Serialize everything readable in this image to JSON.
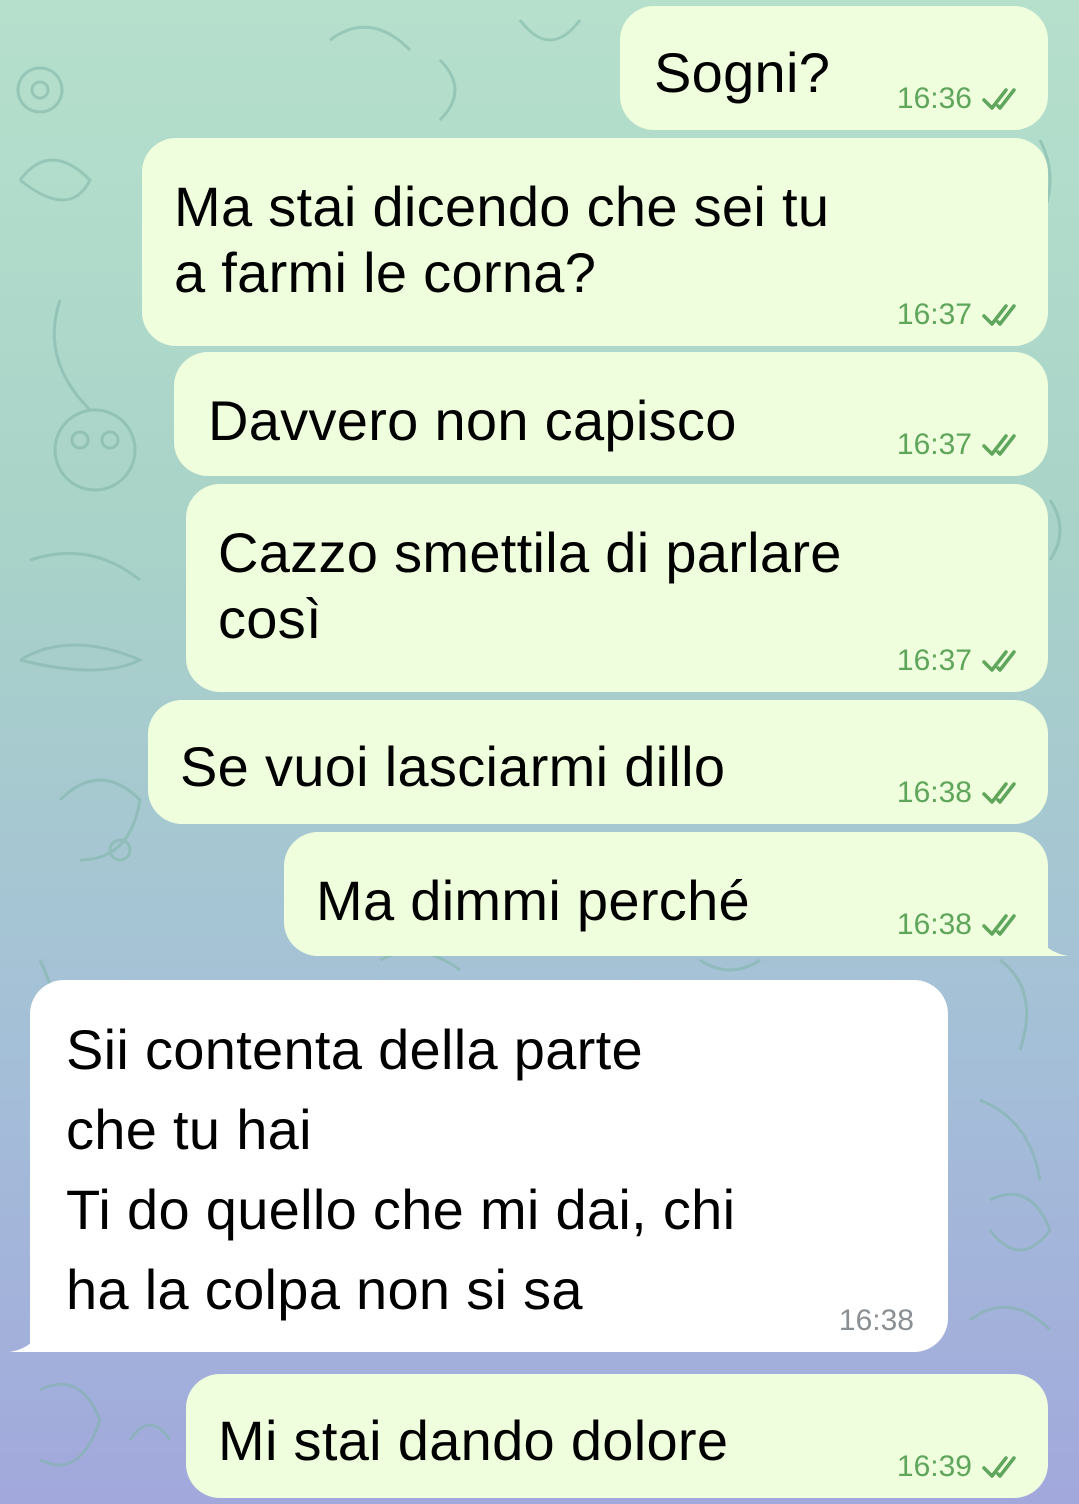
{
  "colors": {
    "outgoing_bubble": "#effedd",
    "incoming_bubble": "#ffffff",
    "time_outgoing": "#5fa55c",
    "time_incoming": "#8a8f94"
  },
  "messages": [
    {
      "direction": "outgoing",
      "text": "Sogni?",
      "time": "16:36",
      "status_icon": "double-check-icon"
    },
    {
      "direction": "outgoing",
      "text": "Ma stai dicendo che sei tu\na farmi le corna?",
      "time": "16:37",
      "status_icon": "double-check-icon"
    },
    {
      "direction": "outgoing",
      "text": "Davvero non capisco",
      "time": "16:37",
      "status_icon": "double-check-icon"
    },
    {
      "direction": "outgoing",
      "text": "Cazzo smettila di parlare\ncosì",
      "time": "16:37",
      "status_icon": "double-check-icon"
    },
    {
      "direction": "outgoing",
      "text": "Se vuoi lasciarmi dillo",
      "time": "16:38",
      "status_icon": "double-check-icon"
    },
    {
      "direction": "outgoing",
      "text": "Ma dimmi perché",
      "time": "16:38",
      "status_icon": "double-check-icon"
    },
    {
      "direction": "incoming",
      "text": "Sii contenta della parte\nche tu hai\nTi do quello che mi dai, chi\nha la colpa non si sa",
      "time": "16:38"
    },
    {
      "direction": "outgoing",
      "text": "Mi stai dando dolore",
      "time": "16:39",
      "status_icon": "double-check-icon"
    }
  ]
}
